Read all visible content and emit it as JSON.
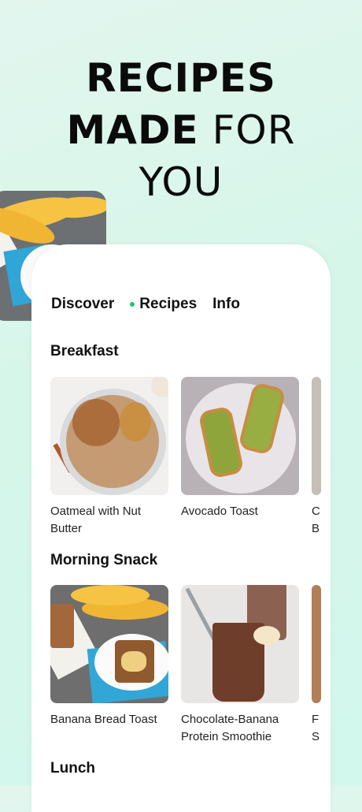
{
  "hero": {
    "line1": "RECIPES",
    "line2_bold": "MADE",
    "line2_light": "FOR",
    "line3": "YOU"
  },
  "tabs": [
    {
      "label": "Discover",
      "active": false
    },
    {
      "label": "Recipes",
      "active": true
    },
    {
      "label": "Info",
      "active": false
    }
  ],
  "sections": [
    {
      "title": "Breakfast",
      "recipes": [
        {
          "name": "Oatmeal with Nut Butter"
        },
        {
          "name": "Avocado Toast"
        },
        {
          "name_partial_line1": "C",
          "name_partial_line2": "B"
        }
      ]
    },
    {
      "title": "Morning Snack",
      "recipes": [
        {
          "name": "Banana Bread Toast"
        },
        {
          "name": "Chocolate-Banana Protein Smoothie"
        },
        {
          "name_partial_line1": "F",
          "name_partial_line2": "S"
        }
      ]
    },
    {
      "title": "Lunch"
    }
  ],
  "colors": {
    "accent_dot": "#27c26a",
    "background": "#d6f6ea"
  }
}
